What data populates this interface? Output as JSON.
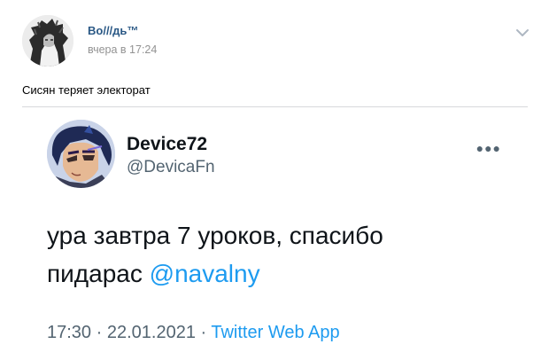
{
  "post": {
    "author": "Во///дь™",
    "time": "вчера в 17:24",
    "text": "Сисян теряет электорат"
  },
  "tweet": {
    "display_name": "Device72",
    "handle": "@DevicaFn",
    "text_line1": "ура завтра 7 уроков, спасибо",
    "text_line2_prefix": "пидарас ",
    "mention": "@navalny",
    "time": "17:30",
    "date": "22.01.2021",
    "separator": " · ",
    "source": "Twitter Web App"
  },
  "icons": {
    "menu": "chevron-down-icon",
    "tweet_more": "more-horizontal-icon"
  },
  "colors": {
    "vk_link": "#2a5885",
    "twitter_blue": "#1d9bf0",
    "twitter_gray": "#536471",
    "divider": "#d7d8db"
  }
}
